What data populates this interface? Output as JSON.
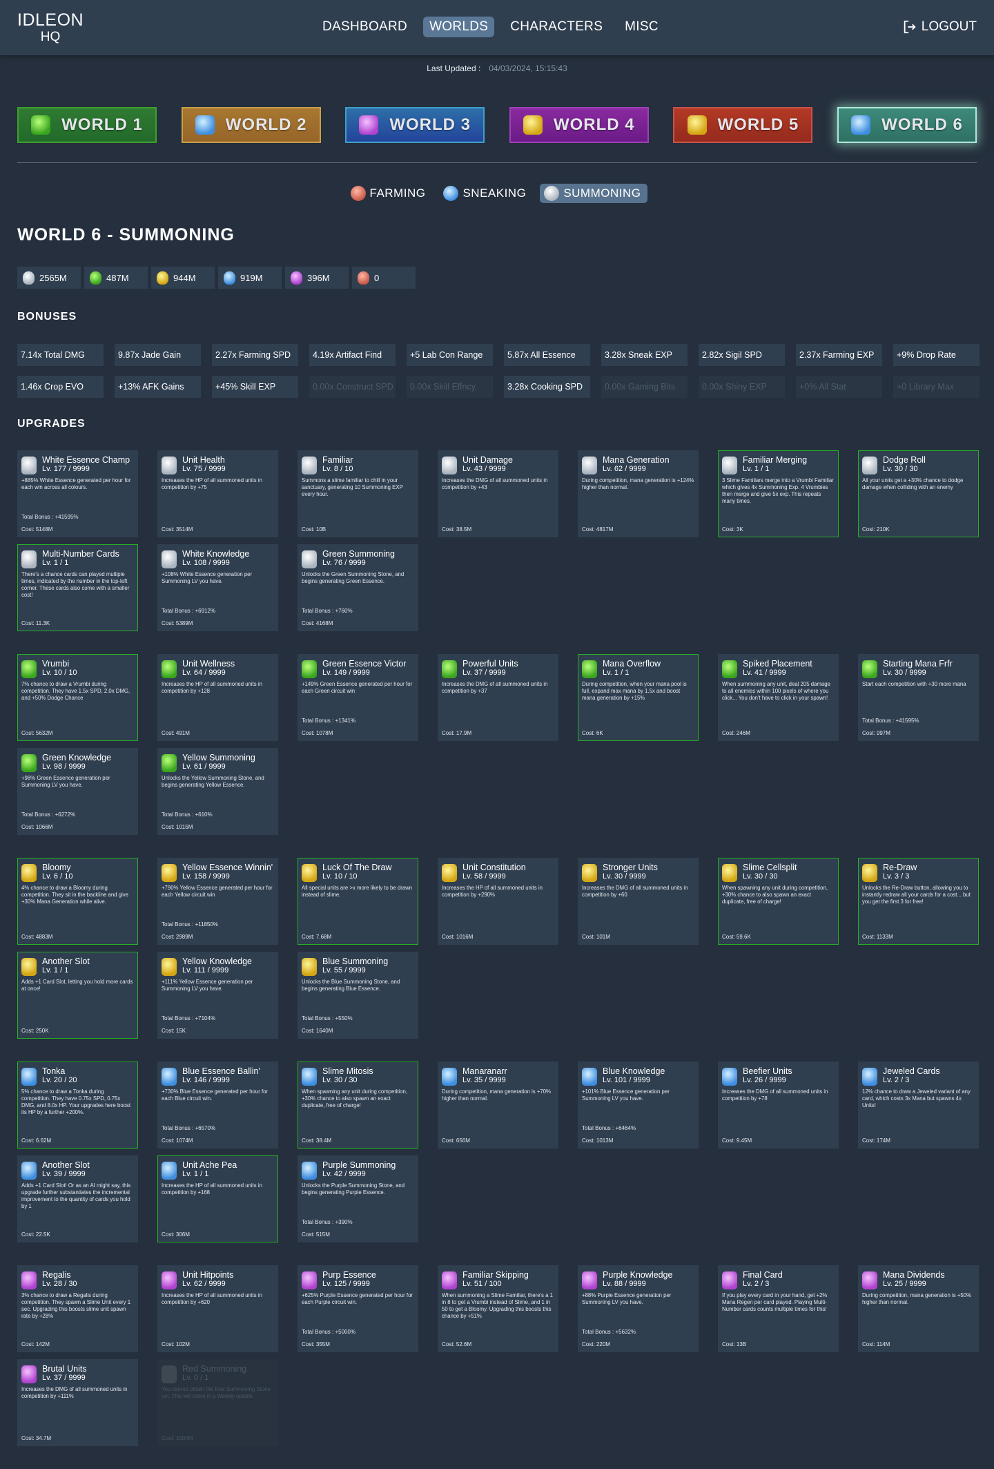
{
  "header": {
    "logo_line1": "IDLEON",
    "logo_line2": "HQ",
    "nav": [
      {
        "label": "DASHBOARD",
        "active": false
      },
      {
        "label": "WORLDS",
        "active": true
      },
      {
        "label": "CHARACTERS",
        "active": false
      },
      {
        "label": "MISC",
        "active": false
      }
    ],
    "logout_label": "LOGOUT",
    "last_updated_label": "Last Updated :",
    "last_updated_value": "04/03/2024, 15:15:43"
  },
  "worlds": [
    {
      "label": "WORLD 1",
      "active": false
    },
    {
      "label": "WORLD 2",
      "active": false
    },
    {
      "label": "WORLD 3",
      "active": false
    },
    {
      "label": "WORLD 4",
      "active": false
    },
    {
      "label": "WORLD 5",
      "active": false
    },
    {
      "label": "WORLD 6",
      "active": true
    }
  ],
  "subtabs": [
    {
      "label": "FARMING",
      "icon": "farming-icon",
      "active": false
    },
    {
      "label": "SNEAKING",
      "icon": "sneaking-icon",
      "active": false
    },
    {
      "label": "SUMMONING",
      "icon": "summoning-icon",
      "active": true
    }
  ],
  "page_title": "WORLD 6 - SUMMONING",
  "essences": [
    {
      "name": "white",
      "icon": "white-essence-icon",
      "value": "2565M"
    },
    {
      "name": "green",
      "icon": "green-essence-icon",
      "value": "487M"
    },
    {
      "name": "yellow",
      "icon": "yellow-essence-icon",
      "value": "944M"
    },
    {
      "name": "blue",
      "icon": "blue-essence-icon",
      "value": "919M"
    },
    {
      "name": "purple",
      "icon": "purple-essence-icon",
      "value": "396M"
    },
    {
      "name": "red",
      "icon": "red-essence-icon",
      "value": "0"
    }
  ],
  "bonuses_title": "BONUSES",
  "bonuses": [
    {
      "label": "7.14x Total DMG",
      "active": true
    },
    {
      "label": "9.87x Jade Gain",
      "active": true
    },
    {
      "label": "2.27x Farming SPD",
      "active": true
    },
    {
      "label": "4.19x Artifact Find",
      "active": true
    },
    {
      "label": "+5 Lab Con Range",
      "active": true
    },
    {
      "label": "5.87x All Essence",
      "active": true
    },
    {
      "label": "3.28x Sneak EXP",
      "active": true
    },
    {
      "label": "2.82x Sigil SPD",
      "active": true
    },
    {
      "label": "2.37x Farming EXP",
      "active": true
    },
    {
      "label": "+9% Drop Rate",
      "active": true
    },
    {
      "label": "1.46x Crop EVO",
      "active": true
    },
    {
      "label": "+13% AFK Gains",
      "active": true
    },
    {
      "label": "+45% Skill EXP",
      "active": true
    },
    {
      "label": "0.00x Construct SPD",
      "active": false
    },
    {
      "label": "0.00x Skill Effncy.",
      "active": false
    },
    {
      "label": "3.28x Cooking SPD",
      "active": true
    },
    {
      "label": "0.00x Gaming Bits",
      "active": false
    },
    {
      "label": "0.00x Shiny EXP",
      "active": false
    },
    {
      "label": "+0% All Stat",
      "active": false
    },
    {
      "label": "+0 Library Max",
      "active": false
    }
  ],
  "upgrades_title": "UPGRADES",
  "upgrade_groups": [
    {
      "color": "white",
      "cards": [
        {
          "name": "White Essence Champ",
          "level": "Lv. 177 / 9999",
          "desc": "+885% White Essence generated per hour for each win across all colours.",
          "total": "Total Bonus : +41595%",
          "cost": "Cost: 5148M",
          "maxed": false
        },
        {
          "name": "Unit Health",
          "level": "Lv. 75 / 9999",
          "desc": "Increases the HP of all summoned units in competition by +75",
          "total": "",
          "cost": "Cost: 3514M",
          "maxed": false
        },
        {
          "name": "Familiar",
          "level": "Lv. 8 / 10",
          "desc": "Summons a slime familiar to chill in your sanctuary, generating 10 Summoning EXP every hour.",
          "total": "",
          "cost": "Cost: 10B",
          "maxed": false
        },
        {
          "name": "Unit Damage",
          "level": "Lv. 43 / 9999",
          "desc": "Increases the DMG of all summoned units in competition by +43",
          "total": "",
          "cost": "Cost: 38.5M",
          "maxed": false
        },
        {
          "name": "Mana Generation",
          "level": "Lv. 62 / 9999",
          "desc": "During competition, mana generation is +124% higher than normal.",
          "total": "",
          "cost": "Cost: 4817M",
          "maxed": false
        },
        {
          "name": "Familiar Merging",
          "level": "Lv. 1 / 1",
          "desc": "3 Slime Familiars merge into a Vrumbi Familiar which gives 4x Summoning Exp. 4 Vrumbies then merge and give 5x exp. This repeats many times.",
          "total": "",
          "cost": "Cost: 3K",
          "maxed": true
        },
        {
          "name": "Dodge Roll",
          "level": "Lv. 30 / 30",
          "desc": "All your units get a +30% chance to dodge damage when colliding with an enemy",
          "total": "",
          "cost": "Cost: 210K",
          "maxed": true
        },
        {
          "name": "Multi-Number Cards",
          "level": "Lv. 1 / 1",
          "desc": "There's a chance cards can played multiple times, indicated by the number in the top-left corner. These cards also come with a smaller cost!",
          "total": "",
          "cost": "Cost: 11.3K",
          "maxed": true
        },
        {
          "name": "White Knowledge",
          "level": "Lv. 108 / 9999",
          "desc": "+108% White Essence generation per Summoning LV you have.",
          "total": "Total Bonus : +6912%",
          "cost": "Cost: 5389M",
          "maxed": false
        },
        {
          "name": "Green Summoning",
          "level": "Lv. 76 / 9999",
          "desc": "Unlocks the Green Summoning Stone, and begins generating Green Essence.",
          "total": "Total Bonus : +760%",
          "cost": "Cost: 4168M",
          "maxed": false
        }
      ]
    },
    {
      "color": "green",
      "cards": [
        {
          "name": "Vrumbi",
          "level": "Lv. 10 / 10",
          "desc": "7% chance to draw a Vrumbi during competition. They have 1.5x SPD, 2.0x DMG, and +50% Dodge Chance",
          "total": "",
          "cost": "Cost: 5632M",
          "maxed": true
        },
        {
          "name": "Unit Wellness",
          "level": "Lv. 64 / 9999",
          "desc": "Increases the HP of all summoned units in competition by +128",
          "total": "",
          "cost": "Cost: 491M",
          "maxed": false
        },
        {
          "name": "Green Essence Victor",
          "level": "Lv. 149 / 9999",
          "desc": "+149% Green Essence generated per hour for each Green circuit win",
          "total": "Total Bonus : +1341%",
          "cost": "Cost: 1078M",
          "maxed": false
        },
        {
          "name": "Powerful Units",
          "level": "Lv. 37 / 9999",
          "desc": "Increases the DMG of all summoned units in competition by +37",
          "total": "",
          "cost": "Cost: 17.9M",
          "maxed": false
        },
        {
          "name": "Mana Overflow",
          "level": "Lv. 1 / 1",
          "desc": "During competition, when your mana pool is full, expand max mana by 1.5x and boost mana generation by +15%",
          "total": "",
          "cost": "Cost: 6K",
          "maxed": true
        },
        {
          "name": "Spiked Placement",
          "level": "Lv. 41 / 9999",
          "desc": "When summoning any unit, deal 205 damage to all enemies within 100 pixels of where you click... You don't have to click in your spawn!",
          "total": "",
          "cost": "Cost: 246M",
          "maxed": false
        },
        {
          "name": "Starting Mana Frfr",
          "level": "Lv. 30 / 9999",
          "desc": "Start each competition with +30 more mana",
          "total": "Total Bonus : +41595%",
          "cost": "Cost: 997M",
          "maxed": false
        },
        {
          "name": "Green Knowledge",
          "level": "Lv. 98 / 9999",
          "desc": "+98% Green Essence generation per Summoning LV you have.",
          "total": "Total Bonus : +6272%",
          "cost": "Cost: 1066M",
          "maxed": false
        },
        {
          "name": "Yellow Summoning",
          "level": "Lv. 61 / 9999",
          "desc": "Unlocks the Yellow Summoning Stone, and begins generating Yellow Essence.",
          "total": "Total Bonus : +610%",
          "cost": "Cost: 1015M",
          "maxed": false
        }
      ]
    },
    {
      "color": "yellow",
      "cards": [
        {
          "name": "Bloomy",
          "level": "Lv. 6 / 10",
          "desc": "4% chance to draw a Bloomy during competition. They sit in the backline and give +30% Mana Generation while alive.",
          "total": "",
          "cost": "Cost: 4883M",
          "maxed": true
        },
        {
          "name": "Yellow Essence Winnin'",
          "level": "Lv. 158 / 9999",
          "desc": "+790% Yellow Essence generated per hour for each Yellow circuit win",
          "total": "Total Bonus : +11850%",
          "cost": "Cost: 2989M",
          "maxed": false
        },
        {
          "name": "Luck Of The Draw",
          "level": "Lv. 10 / 10",
          "desc": "All special units are >x more likely to be drawn instead of slime.",
          "total": "",
          "cost": "Cost: 7.68M",
          "maxed": true
        },
        {
          "name": "Unit Constitution",
          "level": "Lv. 58 / 9999",
          "desc": "Increases the HP of all summoned units in competition by +290%",
          "total": "",
          "cost": "Cost: 1016M",
          "maxed": false
        },
        {
          "name": "Stronger Units",
          "level": "Lv. 30 / 9999",
          "desc": "Increases the DMG of all summoned units in competition by +60",
          "total": "",
          "cost": "Cost: 101M",
          "maxed": false
        },
        {
          "name": "Slime Cellsplit",
          "level": "Lv. 30 / 30",
          "desc": "When spawning any unit during competition, +30% chance to also spawn an exact duplicate, free of charge!",
          "total": "",
          "cost": "Cost: 59.6K",
          "maxed": true
        },
        {
          "name": "Re-Draw",
          "level": "Lv. 3 / 3",
          "desc": "Unlocks the Re-Draw button, allowing you to instantly redraw all your cards for a cost... but you get the first 3 for free!",
          "total": "",
          "cost": "Cost: 1133M",
          "maxed": true
        },
        {
          "name": "Another Slot",
          "level": "Lv. 1 / 1",
          "desc": "Adds +1 Card Slot, letting you hold more cards at once!",
          "total": "",
          "cost": "Cost: 250K",
          "maxed": true
        },
        {
          "name": "Yellow Knowledge",
          "level": "Lv. 111 / 9999",
          "desc": "+111% Yellow Essence generation per Summoning LV you have.",
          "total": "Total Bonus : +7104%",
          "cost": "Cost: 15K",
          "maxed": false
        },
        {
          "name": "Blue Summoning",
          "level": "Lv. 55 / 9999",
          "desc": "Unlocks the Blue Summoning Stone, and begins generating Blue Essence.",
          "total": "Total Bonus : +550%",
          "cost": "Cost: 1640M",
          "maxed": false
        }
      ]
    },
    {
      "color": "blue",
      "cards": [
        {
          "name": "Tonka",
          "level": "Lv. 20 / 20",
          "desc": "5% chance to draw a Tonka during competition. They have 0.75x SPD, 0.75x DMG, and 8.0x HP. Your upgrades here boost its HP by a further +200%.",
          "total": "",
          "cost": "Cost: 6.62M",
          "maxed": true
        },
        {
          "name": "Blue Essence Ballin'",
          "level": "Lv. 146 / 9999",
          "desc": "+730% Blue Essence generated per hour for each Blue circuit win.",
          "total": "Total Bonus : +6570%",
          "cost": "Cost: 1074M",
          "maxed": false
        },
        {
          "name": "Slime Mitosis",
          "level": "Lv. 30 / 30",
          "desc": "When spawning any unit during competition, +30% chance to also spawn an exact duplicate, free of charge!",
          "total": "",
          "cost": "Cost: 38.4M",
          "maxed": true
        },
        {
          "name": "Manaranarr",
          "level": "Lv. 35 / 9999",
          "desc": "During competition, mana generation is +70% higher than normal.",
          "total": "",
          "cost": "Cost: 656M",
          "maxed": false
        },
        {
          "name": "Blue Knowledge",
          "level": "Lv. 101 / 9999",
          "desc": "+101% Blue Essence generation per Summoning LV you have.",
          "total": "Total Bonus : +6464%",
          "cost": "Cost: 1013M",
          "maxed": false
        },
        {
          "name": "Beefier Units",
          "level": "Lv. 26 / 9999",
          "desc": "Increases the DMG of all summoned units in competition by +78",
          "total": "",
          "cost": "Cost: 9.45M",
          "maxed": false
        },
        {
          "name": "Jeweled Cards",
          "level": "Lv. 2 / 3",
          "desc": "12% chance to draw a Jeweled variant of any card, which costs 3x Mana but spawns 4x Units!",
          "total": "",
          "cost": "Cost: 174M",
          "maxed": false
        },
        {
          "name": "Another Slot",
          "level": "Lv. 39 / 9999",
          "desc": "Adds +1 Card Slot! Or as an AI might say, this upgrade further substantiates the incremental improvement to the quantity of cards you hold by 1",
          "total": "",
          "cost": "Cost: 22.5K",
          "maxed": false
        },
        {
          "name": "Unit Ache Pea",
          "level": "Lv. 1 / 1",
          "desc": "Increases the HP of all summoned units in competition by +168",
          "total": "",
          "cost": "Cost: 306M",
          "maxed": true
        },
        {
          "name": "Purple Summoning",
          "level": "Lv. 42 / 9999",
          "desc": "Unlocks the Purple Summoning Stone, and begins generating Purple Essence.",
          "total": "Total Bonus : +390%",
          "cost": "Cost: 515M",
          "maxed": false
        }
      ]
    },
    {
      "color": "purple",
      "cards": [
        {
          "name": "Regalis",
          "level": "Lv. 28 / 30",
          "desc": "3% chance to draw a Regalis during competition. They spawn a Slime Unit every 1 sec. Upgrading this boosts slime unit spawn rate by +28%",
          "total": "",
          "cost": "Cost: 142M",
          "maxed": false
        },
        {
          "name": "Unit Hitpoints",
          "level": "Lv. 62 / 9999",
          "desc": "Increases the HP of all summoned units in competition by +620",
          "total": "",
          "cost": "Cost: 102M",
          "maxed": false
        },
        {
          "name": "Purp Essence",
          "level": "Lv. 125 / 9999",
          "desc": "+625% Purple Essence generated per hour for each Purple circuit win.",
          "total": "Total Bonus : +5000%",
          "cost": "Cost: 355M",
          "maxed": false
        },
        {
          "name": "Familiar Skipping",
          "level": "Lv. 51 / 100",
          "desc": "When summoning a Slime Familiar, there's a 1 in 8 to get a Vrumbi instead of Slime, and 1 in 50 to get a Bloomy. Upgrading this boosts this chance by +51%",
          "total": "",
          "cost": "Cost: 52.6M",
          "maxed": false
        },
        {
          "name": "Purple Knowledge",
          "level": "Lv. 88 / 9999",
          "desc": "+88% Purple Essence generation per Summoning LV you have.",
          "total": "Total Bonus : +5632%",
          "cost": "Cost: 220M",
          "maxed": false
        },
        {
          "name": "Final Card",
          "level": "Lv. 2 / 3",
          "desc": "If you play every card in your hand, get +2% Mana Regen per card played. Playing Multi-Number cards counts multiple times for this!",
          "total": "",
          "cost": "Cost: 13B",
          "maxed": false
        },
        {
          "name": "Mana Dividends",
          "level": "Lv. 25 / 9999",
          "desc": "During competition, mana generation is +50% higher than normal.",
          "total": "",
          "cost": "Cost: 114M",
          "maxed": false
        },
        {
          "name": "Brutal Units",
          "level": "Lv. 37 / 9999",
          "desc": "Increases the DMG of all summoned units in competition by +111%",
          "total": "",
          "cost": "Cost: 34.7M",
          "maxed": false
        },
        {
          "name": "Red Summoning",
          "level": "Lv. 0 / 1",
          "desc": "You cannot obtain the Red Summoning Stone yet. This will come in a Weekly update.",
          "total": "",
          "cost": "Cost: 1000M",
          "maxed": false,
          "locked": true
        }
      ]
    }
  ]
}
